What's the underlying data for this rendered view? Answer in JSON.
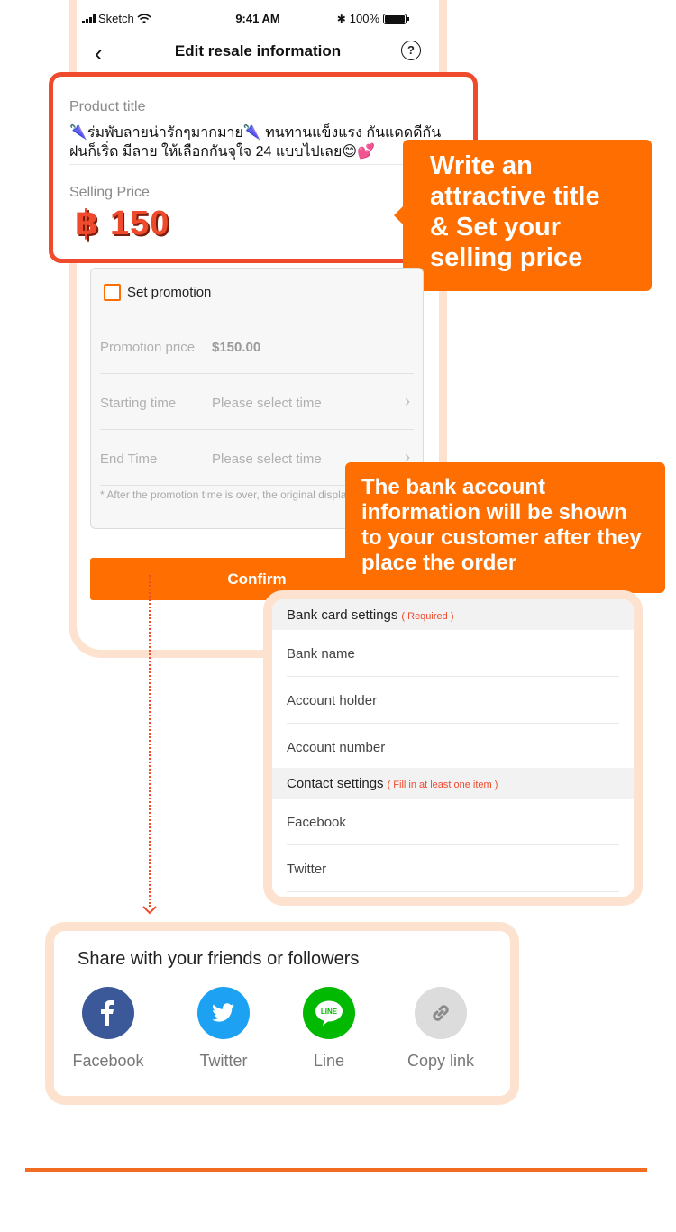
{
  "status_bar": {
    "carrier": "Sketch",
    "time": "9:41 AM",
    "battery": "100%"
  },
  "nav": {
    "title": "Edit resale information",
    "help": "?"
  },
  "product": {
    "title_label": "Product title",
    "title_value": "🌂ร่มพับลายน่ารักๆมากมาย🌂 ทนทานแข็งแรง กันแดดดีกันฝนก็เริ่ด มีลาย ให้เลือกกันจุใจ 24 แบบไปเลย😊💕",
    "price_label": "Selling Price",
    "price_value": "฿ 150"
  },
  "callout_title": "Write an attractive title & Set your selling price",
  "promotion": {
    "label": "Set promotion",
    "checked": false,
    "rows": [
      {
        "key": "Promotion price",
        "value": "$150.00"
      },
      {
        "key": "Starting time",
        "value": "Please select time"
      },
      {
        "key": "End Time",
        "value": "Please select time"
      }
    ],
    "note": "* After the promotion time is over, the original displayed."
  },
  "confirm_label": "Confirm",
  "callout_bank": "The bank account information will be shown to your customer after they place the order",
  "bank": {
    "section_title": "Bank card settings",
    "section_required": "( Required )",
    "fields": [
      "Bank name",
      "Account holder",
      "Account number"
    ],
    "contact_title": "Contact settings",
    "contact_note": "( Fill in at least one item )",
    "contacts": [
      "Facebook",
      "Twitter"
    ]
  },
  "share": {
    "title": "Share with your friends or followers",
    "items": [
      {
        "label": "Facebook",
        "icon": "facebook-icon",
        "color": "#3b5998"
      },
      {
        "label": "Twitter",
        "icon": "twitter-icon",
        "color": "#1da1f2"
      },
      {
        "label": "Line",
        "icon": "line-icon",
        "color": "#00b900"
      },
      {
        "label": "Copy link",
        "icon": "link-icon",
        "color": "#dcdcdc"
      }
    ]
  },
  "colors": {
    "accent": "#fe6e00",
    "highlight": "#f04a2d",
    "frame": "#fde3cf"
  }
}
